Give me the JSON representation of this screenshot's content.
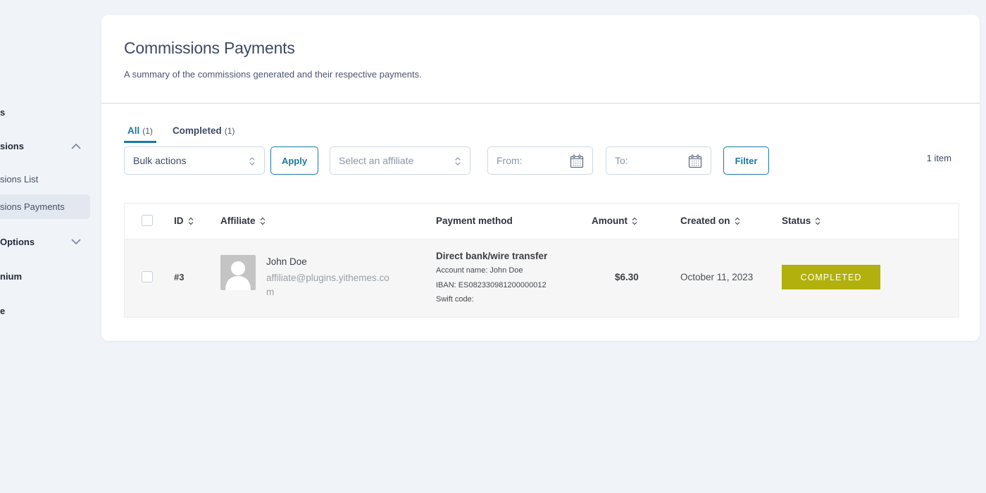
{
  "colors": {
    "accent": "#1a7aa0",
    "status_completed": "#b2b00d",
    "background": "#f0f3f8"
  },
  "sidebar": {
    "items": [
      {
        "label": "Affiliates",
        "visible_fragment": "s",
        "type": "link"
      },
      {
        "label": "Commissions",
        "visible_fragment": "sions",
        "type": "group",
        "expanded": true,
        "icon": "chevron-up-icon"
      },
      {
        "label": "Commissions List",
        "visible_fragment": "sions List",
        "type": "subitem"
      },
      {
        "label": "Commissions Payments",
        "visible_fragment": "sions Payments",
        "type": "subitem",
        "active": true
      },
      {
        "label": "Options",
        "visible_fragment": "Options",
        "type": "group",
        "expanded": false,
        "icon": "chevron-down-icon"
      },
      {
        "label": "Premium",
        "visible_fragment": "nium",
        "type": "link"
      },
      {
        "label": "e",
        "visible_fragment": "e",
        "type": "link"
      }
    ]
  },
  "header": {
    "title": "Commissions Payments",
    "description": "A summary of the commissions generated and their respective payments."
  },
  "tabs": [
    {
      "label": "All",
      "count": "(1)",
      "active": true
    },
    {
      "label": "Completed",
      "count": "(1)",
      "active": false
    }
  ],
  "filters": {
    "bulk_actions": {
      "value": "Bulk actions"
    },
    "apply_label": "Apply",
    "affiliate_select": {
      "placeholder": "Select an affiliate"
    },
    "from": {
      "placeholder": "From:"
    },
    "to": {
      "placeholder": "To:"
    },
    "filter_label": "Filter",
    "items_count": "1 item"
  },
  "table": {
    "columns": [
      {
        "key": "id",
        "label": "ID",
        "sortable": true
      },
      {
        "key": "affiliate",
        "label": "Affiliate",
        "sortable": true
      },
      {
        "key": "payment_method",
        "label": "Payment method",
        "sortable": false
      },
      {
        "key": "amount",
        "label": "Amount",
        "sortable": true
      },
      {
        "key": "created_on",
        "label": "Created on",
        "sortable": true
      },
      {
        "key": "status",
        "label": "Status",
        "sortable": true
      }
    ],
    "rows": [
      {
        "id": "#3",
        "affiliate": {
          "name": "John Doe",
          "email": "affiliate@plugins.yithemes.com"
        },
        "payment_method": {
          "title": "Direct bank/wire transfer",
          "account_name": "Account name: John Doe",
          "iban": "IBAN: ES082330981200000012",
          "swift": "Swift code:"
        },
        "amount": "$6.30",
        "created_on": "October 11, 2023",
        "status": "COMPLETED"
      }
    ]
  }
}
